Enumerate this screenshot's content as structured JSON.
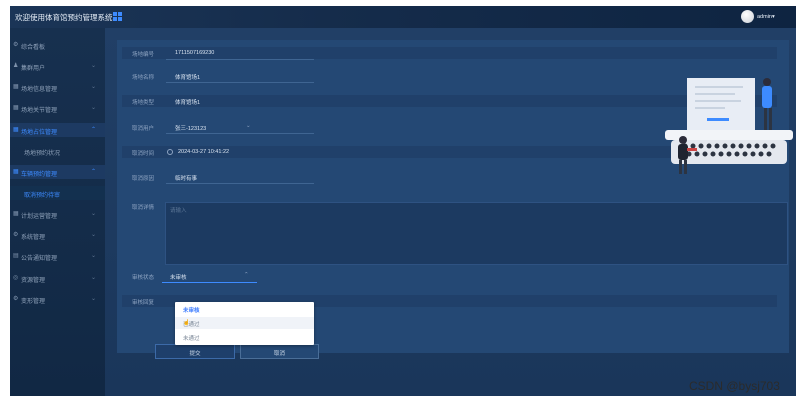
{
  "header": {
    "title": "欢迎使用体育馆预约管理系统",
    "user": "admin"
  },
  "sidebar": {
    "items": [
      {
        "icon": "home-icon",
        "label": "综合看板",
        "has_arrow": false
      },
      {
        "icon": "user-icon",
        "label": "集群用户",
        "has_arrow": true
      },
      {
        "icon": "grid-icon",
        "label": "场地信息管理",
        "has_arrow": true
      },
      {
        "icon": "grid-icon",
        "label": "场地关节管理",
        "has_arrow": true
      },
      {
        "icon": "grid-icon",
        "label": "场地占位管理",
        "has_arrow": true,
        "active": true
      },
      {
        "label": "场地预约状况",
        "sub": true
      },
      {
        "icon": "grid-icon",
        "label": "车辆预约管理",
        "has_arrow": true,
        "active": true
      },
      {
        "label": "取消预约待审",
        "sub": true,
        "sub_active": true
      },
      {
        "icon": "grid-icon",
        "label": "计划运营管理",
        "has_arrow": true
      },
      {
        "icon": "gear-icon",
        "label": "系统管理",
        "has_arrow": true
      },
      {
        "icon": "doc-icon",
        "label": "公告通知管理",
        "has_arrow": true
      },
      {
        "icon": "shield-icon",
        "label": "资源管理",
        "has_arrow": true
      },
      {
        "icon": "gear-icon",
        "label": "变形管理",
        "has_arrow": true
      }
    ]
  },
  "form": {
    "order_no": {
      "label": "场地编号",
      "value": "1711507169230"
    },
    "venue_name": {
      "label": "场地名称",
      "value": "体育馆场1"
    },
    "venue_type": {
      "label": "场地类型",
      "value": "体育馆场1"
    },
    "user": {
      "label": "取消用户",
      "value": "张三-123123"
    },
    "time": {
      "label": "取消时间",
      "value": "2024-03-27 10:41:22"
    },
    "reason": {
      "label": "取消原因",
      "value": "临时有事"
    },
    "detail": {
      "label": "取消详情",
      "placeholder": "请输入"
    },
    "status": {
      "label": "审核状态",
      "value": "未审核"
    },
    "result": {
      "label": "审核回复"
    }
  },
  "dropdown": {
    "options": [
      "未审核",
      "已通过",
      "未通过"
    ],
    "selected": "未审核"
  },
  "buttons": {
    "save": "提交",
    "cancel": "取消"
  },
  "watermark": "CSDN @bysj703",
  "colors": {
    "accent": "#3d8bff",
    "background": "#0e2441",
    "panel": "#244874"
  }
}
